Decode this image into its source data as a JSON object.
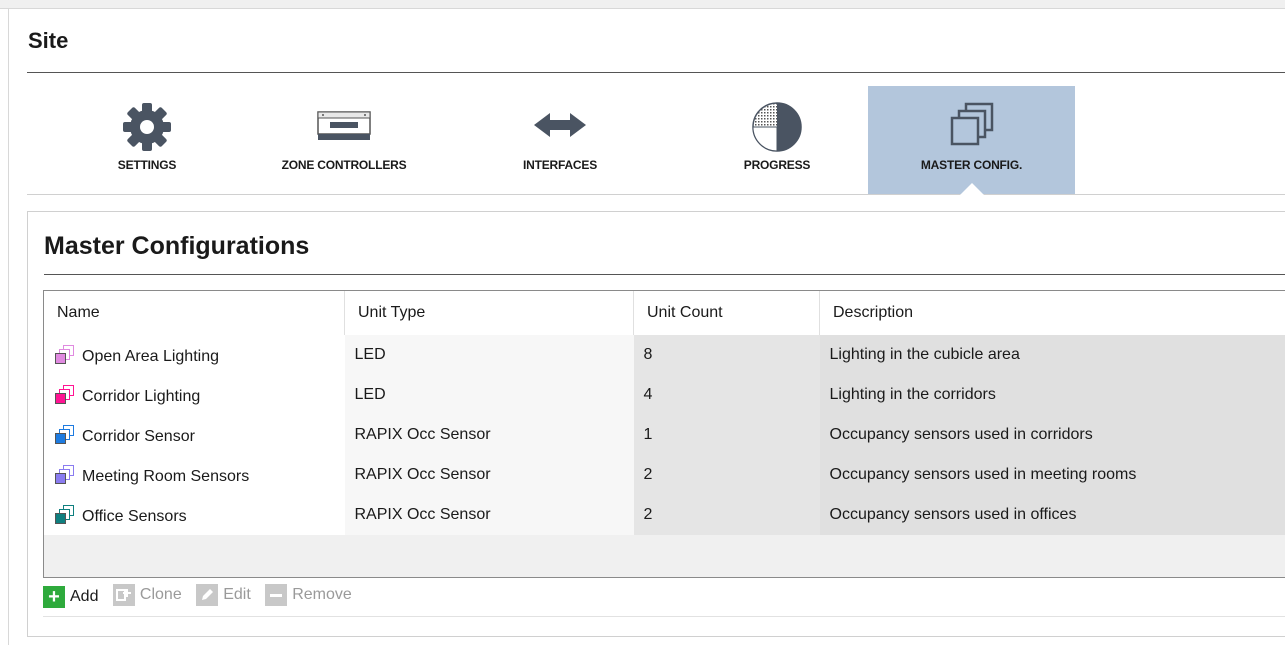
{
  "site": {
    "title": "Site"
  },
  "nav": {
    "items": [
      {
        "label": "SETTINGS",
        "icon": "gear-icon"
      },
      {
        "label": "ZONE CONTROLLERS",
        "icon": "zone-controller-icon"
      },
      {
        "label": "INTERFACES",
        "icon": "interfaces-arrows-icon"
      },
      {
        "label": "PROGRESS",
        "icon": "progress-pie-icon"
      },
      {
        "label": "MASTER CONFIG.",
        "icon": "master-config-icon",
        "active": true
      }
    ]
  },
  "panel": {
    "title": "Master Configurations",
    "columns": [
      "Name",
      "Unit Type",
      "Unit Count",
      "Description"
    ],
    "rows": [
      {
        "name": "Open Area Lighting",
        "unit_type": "LED",
        "unit_count": "8",
        "description": "Lighting in the cubicle area",
        "color": "#e08ae0"
      },
      {
        "name": "Corridor Lighting",
        "unit_type": "LED",
        "unit_count": "4",
        "description": "Lighting in the corridors",
        "color": "#ff1493"
      },
      {
        "name": "Corridor Sensor",
        "unit_type": "RAPIX Occ Sensor",
        "unit_count": "1",
        "description": "Occupancy sensors used in corridors",
        "color": "#1e7be0"
      },
      {
        "name": "Meeting Room Sensors",
        "unit_type": "RAPIX Occ Sensor",
        "unit_count": "2",
        "description": "Occupancy sensors used in meeting rooms",
        "color": "#8a7cf0"
      },
      {
        "name": "Office Sensors",
        "unit_type": "RAPIX Occ Sensor",
        "unit_count": "2",
        "description": "Occupancy sensors used in offices",
        "color": "#0f7f7f"
      }
    ]
  },
  "toolbar": {
    "add": "Add",
    "clone": "Clone",
    "edit": "Edit",
    "remove": "Remove"
  },
  "colors": {
    "active_tab": "#b3c6dc",
    "add_green": "#2eaa3c",
    "disabled": "#c8c8c8"
  }
}
